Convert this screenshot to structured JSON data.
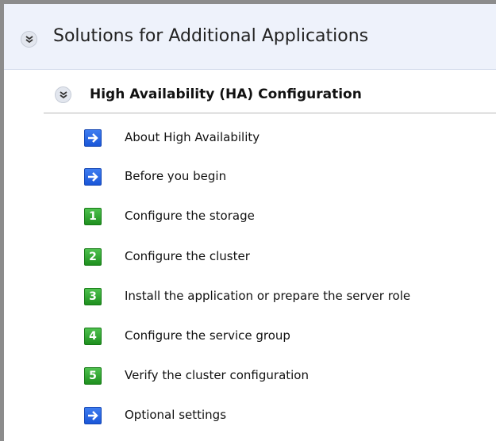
{
  "header": {
    "title": "Solutions for Additional Applications"
  },
  "section": {
    "title": "High Availability (HA) Configuration"
  },
  "items": [
    {
      "label": "About High Availability",
      "icon": "arrow-right-icon",
      "badge": ""
    },
    {
      "label": "Before you begin",
      "icon": "arrow-right-icon",
      "badge": ""
    },
    {
      "label": "Configure the storage",
      "icon": "step-1-icon",
      "badge": "1"
    },
    {
      "label": "Configure the cluster",
      "icon": "step-2-icon",
      "badge": "2"
    },
    {
      "label": "Install the application or prepare the server role",
      "icon": "step-3-icon",
      "badge": "3"
    },
    {
      "label": "Configure the service group",
      "icon": "step-4-icon",
      "badge": "4"
    },
    {
      "label": "Verify the cluster configuration",
      "icon": "step-5-icon",
      "badge": "5"
    },
    {
      "label": "Optional settings",
      "icon": "arrow-right-icon",
      "badge": ""
    }
  ],
  "colors": {
    "accent_blue": "#1a56d8",
    "step_green": "#2a9d2a",
    "header_bg": "#eef2fb"
  }
}
